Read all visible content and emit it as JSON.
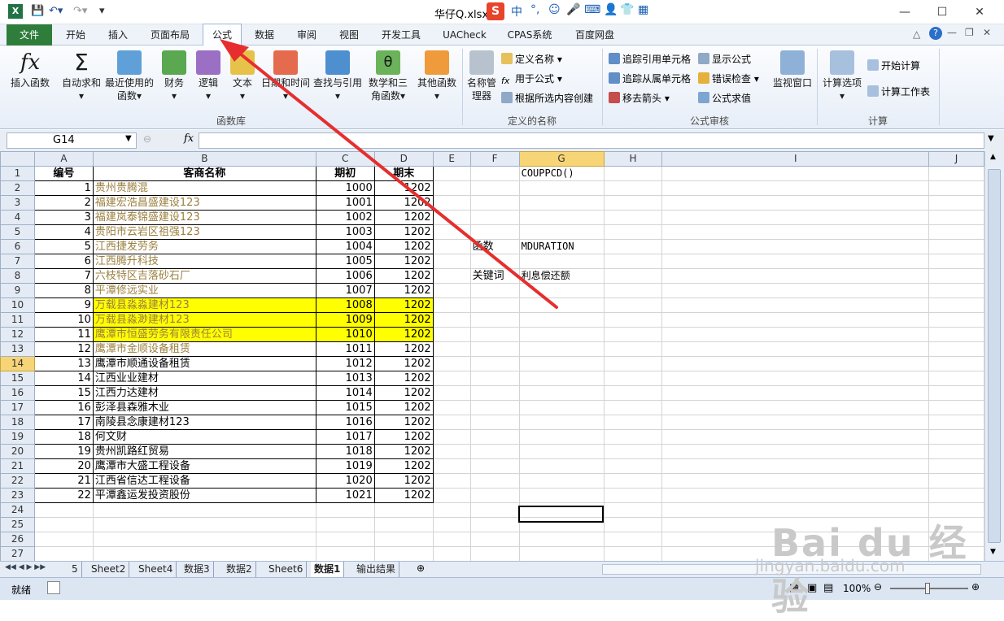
{
  "window": {
    "title": "华仔Q.xlsx",
    "ime_icon": "S",
    "ime_lang": "中"
  },
  "tabs": [
    "文件",
    "开始",
    "插入",
    "页面布局",
    "公式",
    "数据",
    "审阅",
    "视图",
    "开发工具",
    "UACheck",
    "CPAS系统",
    "百度网盘"
  ],
  "active_tab": "公式",
  "ribbon": {
    "insert_function": "插入函数",
    "autosum": "自动求和",
    "recent": "最近使用的函数",
    "finance": "财务",
    "logic": "逻辑",
    "text": "文本",
    "datetime": "日期和时间",
    "lookup": "查找与引用",
    "math": "数学和三角函数",
    "other": "其他函数",
    "group_library": "函数库",
    "name_manager": "名称管理器",
    "define_name": "定义名称",
    "use_in_formula": "用于公式",
    "create_from_selection": "根据所选内容创建",
    "group_names": "定义的名称",
    "trace_precedents": "追踪引用单元格",
    "trace_dependents": "追踪从属单元格",
    "remove_arrows": "移去箭头",
    "show_formulas": "显示公式",
    "error_checking": "错误检查",
    "evaluate_formula": "公式求值",
    "watch_window": "监视窗口",
    "group_audit": "公式审核",
    "calc_options": "计算选项",
    "calc_now": "开始计算",
    "calc_sheet": "计算工作表",
    "group_calc": "计算"
  },
  "formula_bar": {
    "name_box": "G14",
    "fx": "fx",
    "value": ""
  },
  "columns": [
    "A",
    "B",
    "C",
    "D",
    "E",
    "F",
    "G",
    "H",
    "I",
    "J"
  ],
  "headers": {
    "a": "编号",
    "b": "客商名称",
    "c": "期初",
    "d": "期末"
  },
  "rows": [
    {
      "a": "1",
      "b": "贵州贵腾混",
      "c": "1000",
      "d": "1202",
      "style": "ol"
    },
    {
      "a": "2",
      "b": "福建宏浩昌盛建设123",
      "c": "1001",
      "d": "1202",
      "style": "ol"
    },
    {
      "a": "3",
      "b": "福建岚泰锦盛建设123",
      "c": "1002",
      "d": "1202",
      "style": "ol"
    },
    {
      "a": "4",
      "b": "贵阳市云岩区祖强123",
      "c": "1003",
      "d": "1202",
      "style": "ol"
    },
    {
      "a": "5",
      "b": "江西捷发劳务",
      "c": "1004",
      "d": "1202",
      "style": "ol"
    },
    {
      "a": "6",
      "b": "江西腾升科技",
      "c": "1005",
      "d": "1202",
      "style": "ol"
    },
    {
      "a": "7",
      "b": "六枝特区吉落砂石厂",
      "c": "1006",
      "d": "1202",
      "style": "ol"
    },
    {
      "a": "8",
      "b": "平潭修远实业",
      "c": "1007",
      "d": "1202",
      "style": "ol"
    },
    {
      "a": "9",
      "b": "万载县淼淼建材123",
      "c": "1008",
      "d": "1202",
      "style": "yl"
    },
    {
      "a": "10",
      "b": "万载县淼渺建材123",
      "c": "1009",
      "d": "1202",
      "style": "yl"
    },
    {
      "a": "11",
      "b": "鹰潭市恒盛劳务有限责任公司",
      "c": "1010",
      "d": "1202",
      "style": "yl"
    },
    {
      "a": "12",
      "b": "鹰潭市金顺设备租赁",
      "c": "1011",
      "d": "1202",
      "style": "ol"
    },
    {
      "a": "13",
      "b": "鹰潭市顺通设备租赁",
      "c": "1012",
      "d": "1202",
      "style": ""
    },
    {
      "a": "14",
      "b": "江西业业建材",
      "c": "1013",
      "d": "1202",
      "style": ""
    },
    {
      "a": "15",
      "b": "江西力达建材",
      "c": "1014",
      "d": "1202",
      "style": ""
    },
    {
      "a": "16",
      "b": "彭泽县森雅木业",
      "c": "1015",
      "d": "1202",
      "style": ""
    },
    {
      "a": "17",
      "b": "南陵县念康建材123",
      "c": "1016",
      "d": "1202",
      "style": ""
    },
    {
      "a": "18",
      "b": "何文财",
      "c": "1017",
      "d": "1202",
      "style": ""
    },
    {
      "a": "19",
      "b": "贵州凯路红贸易",
      "c": "1018",
      "d": "1202",
      "style": ""
    },
    {
      "a": "20",
      "b": "鹰潭市大盛工程设备",
      "c": "1019",
      "d": "1202",
      "style": ""
    },
    {
      "a": "21",
      "b": "江西省信达工程设备",
      "c": "1020",
      "d": "1202",
      "style": ""
    },
    {
      "a": "22",
      "b": "平潭鑫运发投资股份",
      "c": "1021",
      "d": "1202",
      "style": ""
    }
  ],
  "side": {
    "g1": "COUPPCD()",
    "f6": "函数",
    "g6": "MDURATION",
    "f8": "关键词",
    "g8": "利息偿还额"
  },
  "sheets": [
    "5",
    "Sheet2",
    "Sheet4",
    "数据3",
    "数据2",
    "Sheet6",
    "数据1",
    "输出结果"
  ],
  "active_sheet": "数据1",
  "status": {
    "mode": "就绪",
    "zoom": "100%"
  },
  "watermark": {
    "logo": "Bai du 经验",
    "url": "jingyan.baidu.com"
  }
}
